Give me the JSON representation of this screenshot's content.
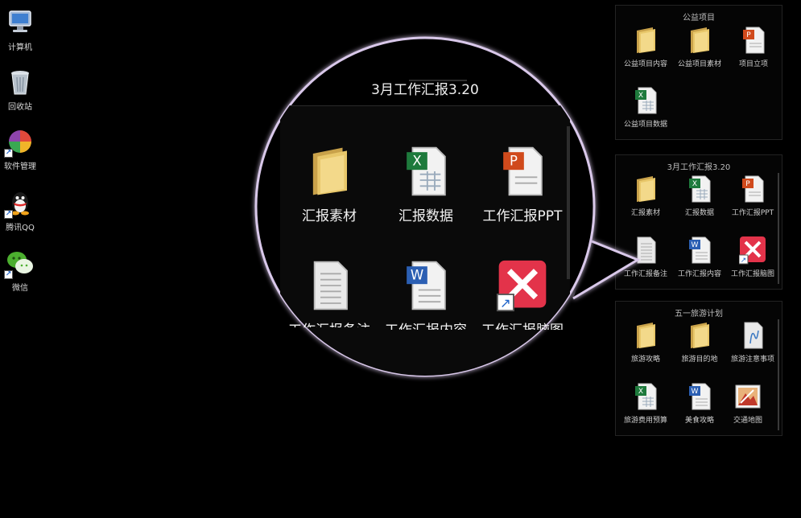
{
  "desktop": {
    "icons": [
      {
        "label": "计算机",
        "icon": "computer-icon"
      },
      {
        "label": "回收站",
        "icon": "recycle-bin-icon"
      },
      {
        "label": "软件管理",
        "icon": "software-manager-icon"
      },
      {
        "label": "腾讯QQ",
        "icon": "qq-icon"
      },
      {
        "label": "微信",
        "icon": "wechat-icon"
      }
    ]
  },
  "fences": [
    {
      "title": "公益项目",
      "items": [
        {
          "label": "公益项目内容",
          "icon": "folder-icon"
        },
        {
          "label": "公益项目素材",
          "icon": "folder-icon"
        },
        {
          "label": "项目立项",
          "icon": "powerpoint-file-icon"
        },
        {
          "label": "公益项目数据",
          "icon": "excel-file-icon"
        }
      ]
    },
    {
      "title": "3月工作汇报3.20",
      "items": [
        {
          "label": "汇报素材",
          "icon": "folder-icon"
        },
        {
          "label": "汇报数据",
          "icon": "excel-file-icon"
        },
        {
          "label": "工作汇报PPT",
          "icon": "powerpoint-file-icon"
        },
        {
          "label": "工作汇报备注",
          "icon": "text-file-icon"
        },
        {
          "label": "工作汇报内容",
          "icon": "word-file-icon"
        },
        {
          "label": "工作汇报脑图",
          "icon": "xmind-icon"
        }
      ]
    },
    {
      "title": "五一旅游计划",
      "items": [
        {
          "label": "旅游攻略",
          "icon": "folder-icon"
        },
        {
          "label": "旅游目的地",
          "icon": "folder-icon"
        },
        {
          "label": "旅游注意事项",
          "icon": "text-file-icon"
        },
        {
          "label": "旅游费用预算",
          "icon": "excel-file-icon"
        },
        {
          "label": "美食攻略",
          "icon": "word-file-icon"
        },
        {
          "label": "交通地图",
          "icon": "image-file-icon"
        }
      ]
    }
  ],
  "magnifier": {
    "title": "3月工作汇报3.20",
    "items": [
      {
        "label": "汇报素材",
        "icon": "folder-icon"
      },
      {
        "label": "汇报数据",
        "icon": "excel-file-icon"
      },
      {
        "label": "工作汇报PPT",
        "icon": "powerpoint-file-icon"
      },
      {
        "label": "工作汇报备注",
        "icon": "text-file-icon"
      },
      {
        "label": "工作汇报内容",
        "icon": "word-file-icon"
      },
      {
        "label": "工作汇报脑图",
        "icon": "xmind-icon"
      }
    ]
  },
  "colors": {
    "excel": "#1e7a3c",
    "word": "#2b5fb3",
    "powerpoint": "#d04a1c",
    "xmind": "#e3334a",
    "folder": "#e8c76a",
    "magnifier_ring": "#d9c8ea"
  }
}
